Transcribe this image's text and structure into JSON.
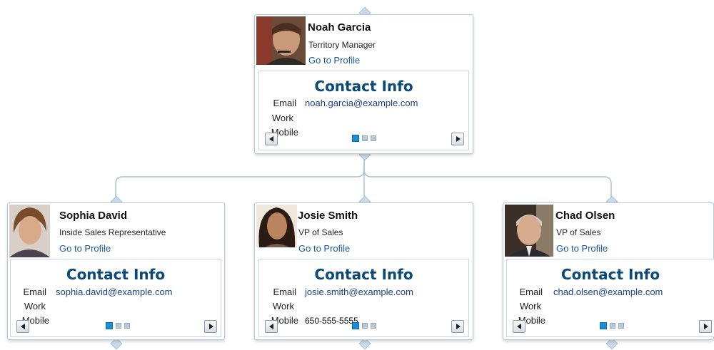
{
  "contact_section_title": "Contact Info",
  "field_labels": {
    "email": "Email",
    "work": "Work",
    "mobile": "Mobile"
  },
  "colors": {
    "accent": "#0b4a78",
    "link": "#1d5aa8",
    "border": "#b4c9da",
    "active_dot": "#1a8fd6",
    "connector": "#a9c1d6"
  },
  "employees": [
    {
      "name": "Noah Garcia",
      "title": "Territory Manager",
      "link": "Go to Profile",
      "email": "noah.garcia@example.com",
      "work": "",
      "mobile": "",
      "page_dots": 3,
      "active_dot": 1
    },
    {
      "name": "Sophia David",
      "title": "Inside Sales Representative",
      "link": "Go to Profile",
      "email": "sophia.david@example.com",
      "work": "",
      "mobile": "",
      "page_dots": 3,
      "active_dot": 1
    },
    {
      "name": "Josie Smith",
      "title": "VP of Sales",
      "link": "Go to Profile",
      "email": "josie.smith@example.com",
      "work": "",
      "mobile": "650-555-5555",
      "page_dots": 3,
      "active_dot": 1
    },
    {
      "name": "Chad Olsen",
      "title": "VP of Sales",
      "link": "Go to Profile",
      "email": "chad.olsen@example.com",
      "work": "",
      "mobile": "",
      "page_dots": 3,
      "active_dot": 1
    }
  ]
}
